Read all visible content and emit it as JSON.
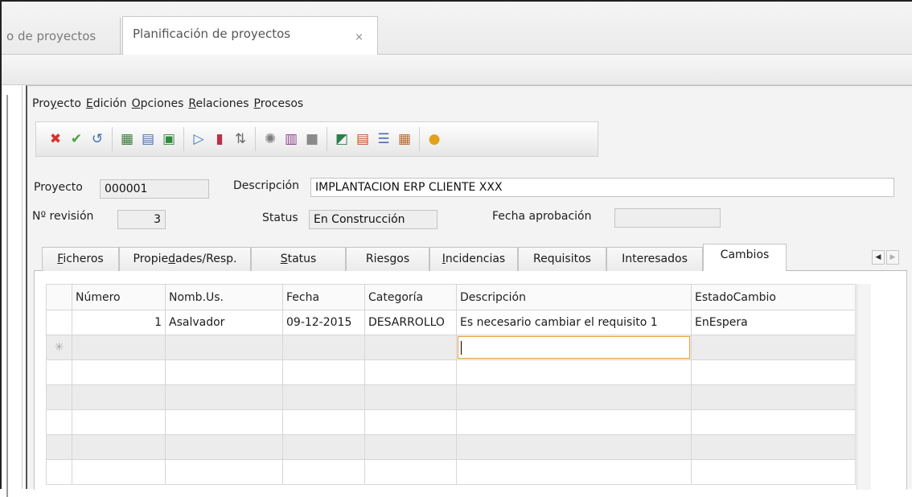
{
  "document_tabs": {
    "prev_label": "o de proyectos",
    "active_label": "Planificación de proyectos",
    "close_glyph": "×"
  },
  "menu": [
    {
      "pre": "Pro",
      "u": "y",
      "post": "ecto"
    },
    {
      "pre": "",
      "u": "E",
      "post": "dición"
    },
    {
      "pre": "",
      "u": "O",
      "post": "pciones"
    },
    {
      "pre": "",
      "u": "R",
      "post": "elaciones"
    },
    {
      "pre": "",
      "u": "P",
      "post": "rocesos"
    }
  ],
  "toolbar_icons": [
    [
      "delete-icon",
      "confirm-icon",
      "undo-icon"
    ],
    [
      "calculator-icon",
      "print-icon",
      "excel-export-icon"
    ],
    [
      "preview-icon",
      "report-icon",
      "sort-icon"
    ],
    [
      "gear-icon",
      "document-icon",
      "block-icon"
    ],
    [
      "chart-icon",
      "bar-report-icon",
      "list-report-icon",
      "matrix-icon"
    ],
    [
      "currency-icon"
    ]
  ],
  "form": {
    "proyecto_label": "Proyecto",
    "proyecto_value": "000001",
    "descripcion_label": "Descripción",
    "descripcion_value": "IMPLANTACION ERP CLIENTE XXX",
    "revision_label": "Nº revisión",
    "revision_value": "3",
    "status_label": "Status",
    "status_value": "En Construcción",
    "fecha_aprobacion_label": "Fecha aprobación",
    "fecha_aprobacion_value": ""
  },
  "section_tabs": [
    {
      "pre": "",
      "u": "F",
      "post": "icheros"
    },
    {
      "pre": "Propie",
      "u": "d",
      "post": "ades/Resp."
    },
    {
      "pre": "",
      "u": "S",
      "post": "tatus"
    },
    {
      "pre": "Ries",
      "u": "g",
      "post": "os"
    },
    {
      "pre": "",
      "u": "I",
      "post": "ncidencias"
    },
    {
      "pre": "Requisitos",
      "u": "",
      "post": ""
    },
    {
      "pre": "Interesados",
      "u": "",
      "post": ""
    },
    {
      "pre": "Cambios",
      "u": "",
      "post": ""
    }
  ],
  "active_section_tab": "Cambios",
  "grid": {
    "columns": [
      "Número",
      "Nomb.Us.",
      "Fecha",
      "Categoría",
      "Descripción",
      "EstadoCambio"
    ],
    "rows": [
      {
        "numero": "1",
        "usuario": "Asalvador",
        "fecha": "09-12-2015",
        "categoria": "DESARROLLO",
        "descripcion": "Es necesario cambiar el requisito 1",
        "estado": "EnEspera"
      }
    ],
    "new_row_marker": "✳"
  },
  "colors": {
    "edit_border": "#e8a23c",
    "delete": "#d9322b",
    "confirm": "#4aa33a"
  }
}
